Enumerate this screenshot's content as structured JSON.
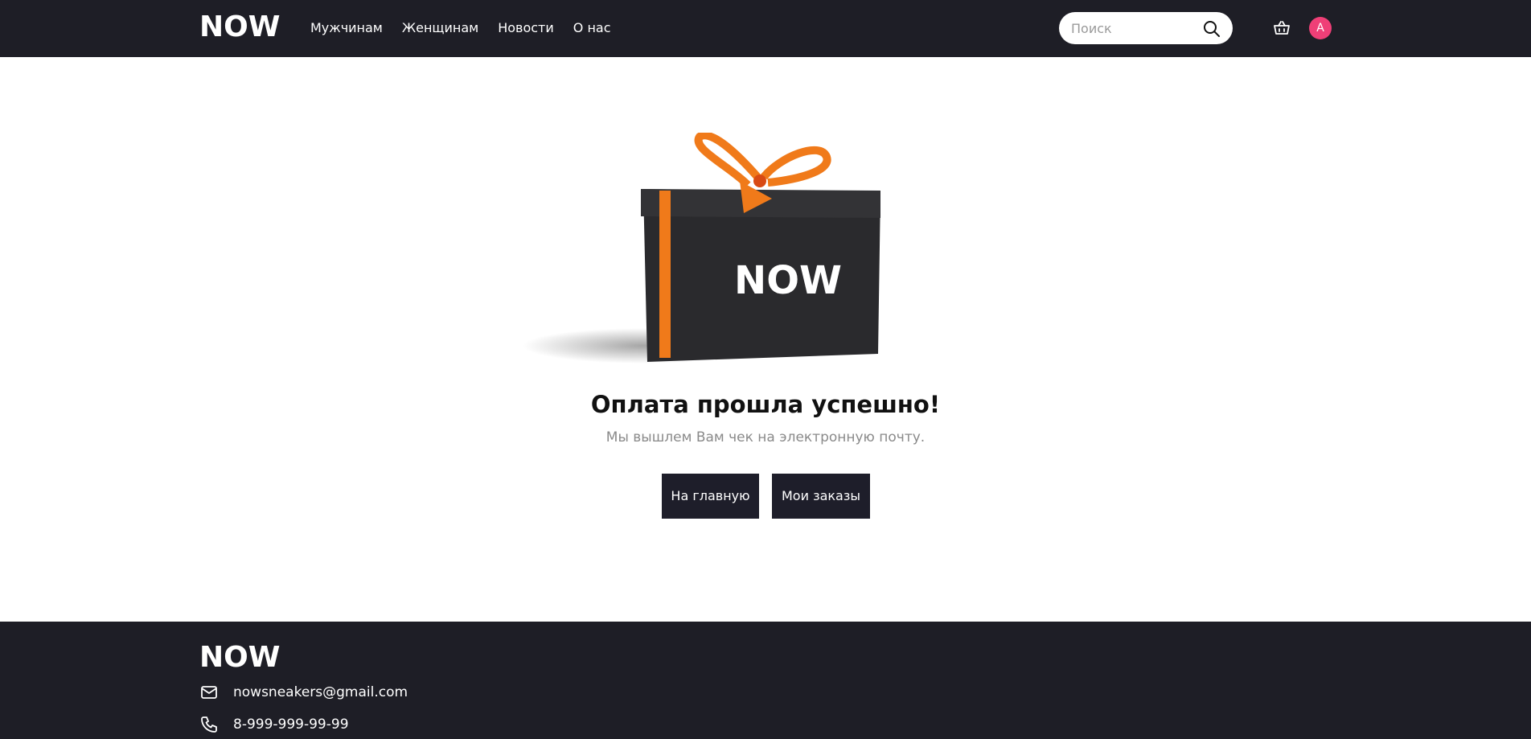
{
  "header": {
    "logo": "NOW",
    "nav": [
      "Мужчинам",
      "Женщинам",
      "Новости",
      "О нас"
    ],
    "search_placeholder": "Поиск",
    "avatar_initial": "A"
  },
  "main": {
    "box_logo": "NOW",
    "title": "Оплата прошла успешно!",
    "subtitle": "Мы вышлем Вам чек на электронную почту.",
    "home_button": "На главную",
    "orders_button": "Мои заказы"
  },
  "footer": {
    "logo": "NOW",
    "email": "nowsneakers@gmail.com",
    "phone": "8-999-999-99-99"
  },
  "colors": {
    "header_bg": "#1e1e26",
    "avatar": "#ef3f77",
    "ribbon": "#f07a1a",
    "button_bg": "#1e1e2a"
  }
}
